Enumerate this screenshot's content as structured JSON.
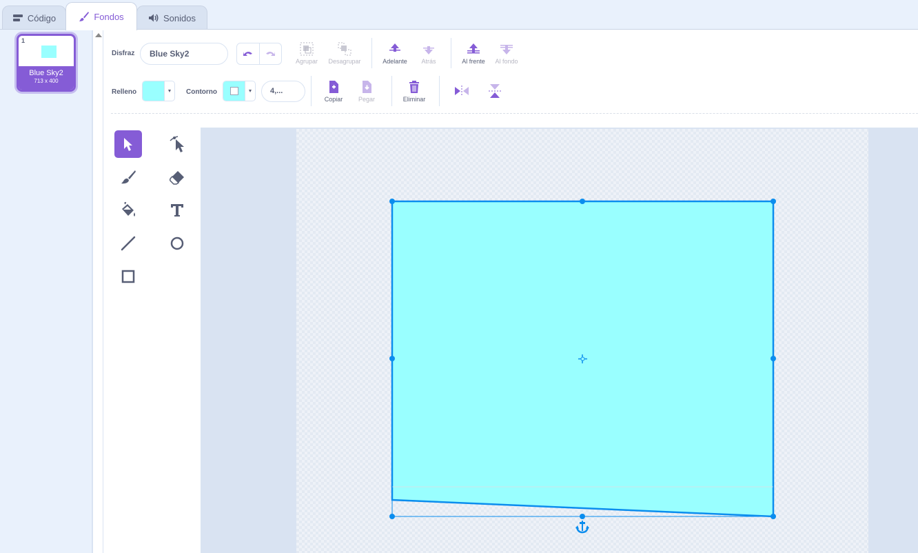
{
  "tabs": [
    {
      "label": "Código",
      "icon": "code-blocks-icon"
    },
    {
      "label": "Fondos",
      "icon": "paintbrush-icon"
    },
    {
      "label": "Sonidos",
      "icon": "speaker-icon"
    }
  ],
  "costume_list": {
    "items": [
      {
        "number": "1",
        "name": "Blue Sky2",
        "size": "713 x 400"
      }
    ]
  },
  "toolbar": {
    "costume_label": "Disfraz",
    "costume_name": "Blue Sky2",
    "group_label": "Agrupar",
    "ungroup_label": "Desagrupar",
    "forward_label": "Adelante",
    "backward_label": "Atrás",
    "front_label": "Al frente",
    "back_label": "Al fondo",
    "fill_label": "Relleno",
    "outline_label": "Contorno",
    "outline_width": "4,...",
    "copy_label": "Copiar",
    "paste_label": "Pegar",
    "delete_label": "Eliminar"
  },
  "colors": {
    "accent": "#855cd6",
    "fill": "#99ffff",
    "outline": "#ffffff",
    "selection": "#0b8dee"
  },
  "tools": [
    "select-tool",
    "reshape-tool",
    "brush-tool",
    "eraser-tool",
    "fill-tool",
    "text-tool",
    "line-tool",
    "circle-tool",
    "rectangle-tool"
  ]
}
